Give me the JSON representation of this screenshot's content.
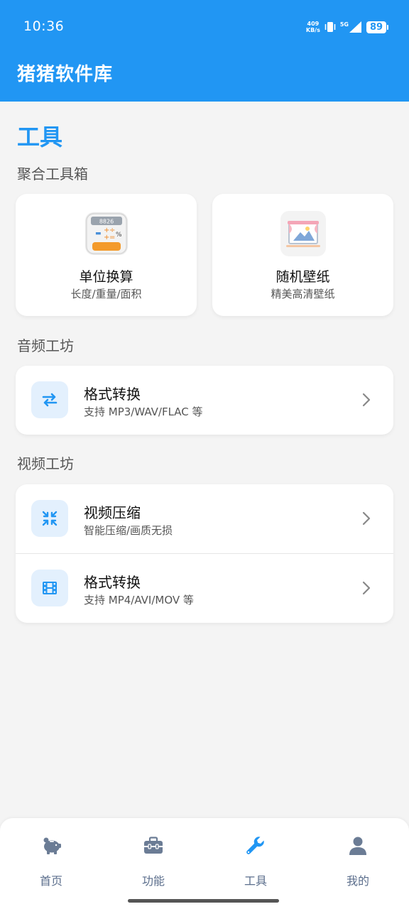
{
  "status_bar": {
    "time": "10:36",
    "net_speed_value": "409",
    "net_speed_unit": "KB/s",
    "network_type": "5G",
    "battery": "89"
  },
  "header": {
    "app_title": "猪猪软件库"
  },
  "page": {
    "title": "工具"
  },
  "aggregate": {
    "label": "聚合工具箱",
    "cards": [
      {
        "title": "单位换算",
        "subtitle": "长度/重量/面积",
        "icon": "calculator-icon",
        "display_text": "8826"
      },
      {
        "title": "随机壁纸",
        "subtitle": "精美高清壁纸",
        "icon": "wallpaper-icon"
      }
    ]
  },
  "audio": {
    "label": "音频工坊",
    "items": [
      {
        "title": "格式转换",
        "subtitle": "支持 MP3/WAV/FLAC 等",
        "icon": "swap-arrows-icon"
      }
    ]
  },
  "video": {
    "label": "视频工坊",
    "items": [
      {
        "title": "视频压缩",
        "subtitle": "智能压缩/画质无损",
        "icon": "compress-icon"
      },
      {
        "title": "格式转换",
        "subtitle": "支持 MP4/AVI/MOV 等",
        "icon": "film-icon"
      }
    ]
  },
  "bottom_nav": {
    "items": [
      {
        "label": "首页",
        "icon": "piggy-bank-icon"
      },
      {
        "label": "功能",
        "icon": "toolbox-icon"
      },
      {
        "label": "工具",
        "icon": "wrench-icon",
        "active": true
      },
      {
        "label": "我的",
        "icon": "user-icon"
      }
    ]
  },
  "colors": {
    "primary": "#2196f3",
    "background": "#f4f4f4",
    "icon_bg": "#e3f0fd",
    "nav_inactive": "#5b6e8c"
  }
}
